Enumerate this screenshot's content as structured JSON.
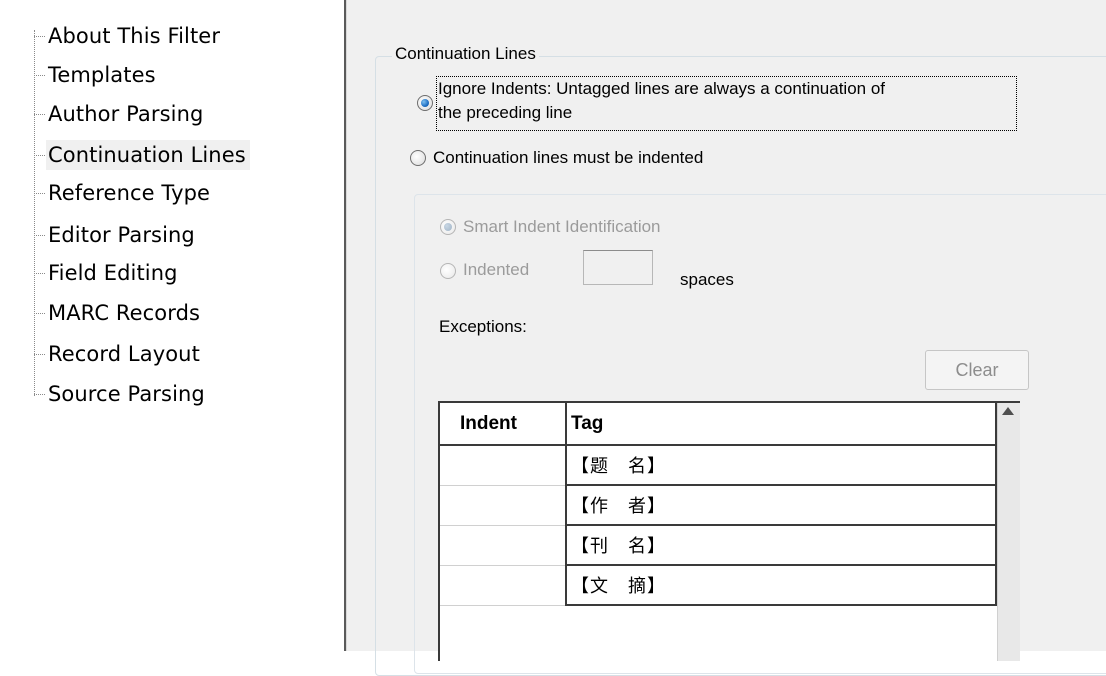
{
  "tree": {
    "items": [
      {
        "label": "About This Filter",
        "selected": false
      },
      {
        "label": "Templates",
        "selected": false
      },
      {
        "label": "Author Parsing",
        "selected": false
      },
      {
        "label": "Continuation Lines",
        "selected": true
      },
      {
        "label": "Reference Type",
        "selected": false
      },
      {
        "label": "Editor Parsing",
        "selected": false
      },
      {
        "label": "Field Editing",
        "selected": false
      },
      {
        "label": "MARC Records",
        "selected": false
      },
      {
        "label": "Record Layout",
        "selected": false
      },
      {
        "label": "Source Parsing",
        "selected": false
      }
    ]
  },
  "group": {
    "title": "Continuation Lines",
    "option_ignore_line1": "Ignore Indents: Untagged lines are always a continuation of",
    "option_ignore_line2": "the preceding line",
    "option_ignore_selected": true,
    "option_indented": "Continuation lines must be indented",
    "option_indented_selected": false
  },
  "indent": {
    "smart_label": "Smart Indent Identification",
    "smart_selected": true,
    "indented_label": "Indented",
    "indented_selected": false,
    "spaces_value": "",
    "spaces_label": "spaces",
    "exceptions_label": "Exceptions:",
    "clear_label": "Clear"
  },
  "table": {
    "headers": {
      "indent": "Indent",
      "tag": "Tag"
    },
    "rows": [
      {
        "indent": "",
        "tag": "【题　名】"
      },
      {
        "indent": "",
        "tag": "【作　者】"
      },
      {
        "indent": "",
        "tag": "【刊　名】"
      },
      {
        "indent": "",
        "tag": "【文　摘】"
      }
    ]
  },
  "colors": {
    "panel_bg": "#f0f0f0",
    "radio_accent": "#1f6fc4",
    "disabled_text": "#9b9b9b"
  }
}
